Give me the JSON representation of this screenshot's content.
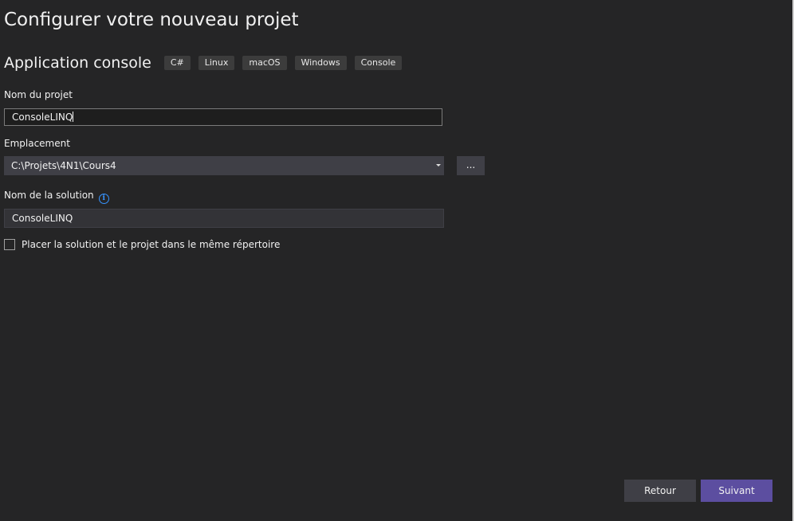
{
  "header": {
    "title": "Configurer votre nouveau projet"
  },
  "template": {
    "name": "Application console",
    "tags": [
      "C#",
      "Linux",
      "macOS",
      "Windows",
      "Console"
    ]
  },
  "form": {
    "project_name": {
      "label": "Nom du projet",
      "value": "ConsoleLINQ"
    },
    "location": {
      "label": "Emplacement",
      "value": "C:\\Projets\\4N1\\Cours4",
      "browse_label": "..."
    },
    "solution_name": {
      "label": "Nom de la solution",
      "value": "ConsoleLINQ",
      "info_icon": "info-icon"
    },
    "same_directory": {
      "label": "Placer la solution et le projet dans le même répertoire",
      "checked": false
    }
  },
  "footer": {
    "back_label": "Retour",
    "next_label": "Suivant"
  },
  "colors": {
    "background": "#252526",
    "accent": "#5c4ea0",
    "info": "#3794ff"
  }
}
